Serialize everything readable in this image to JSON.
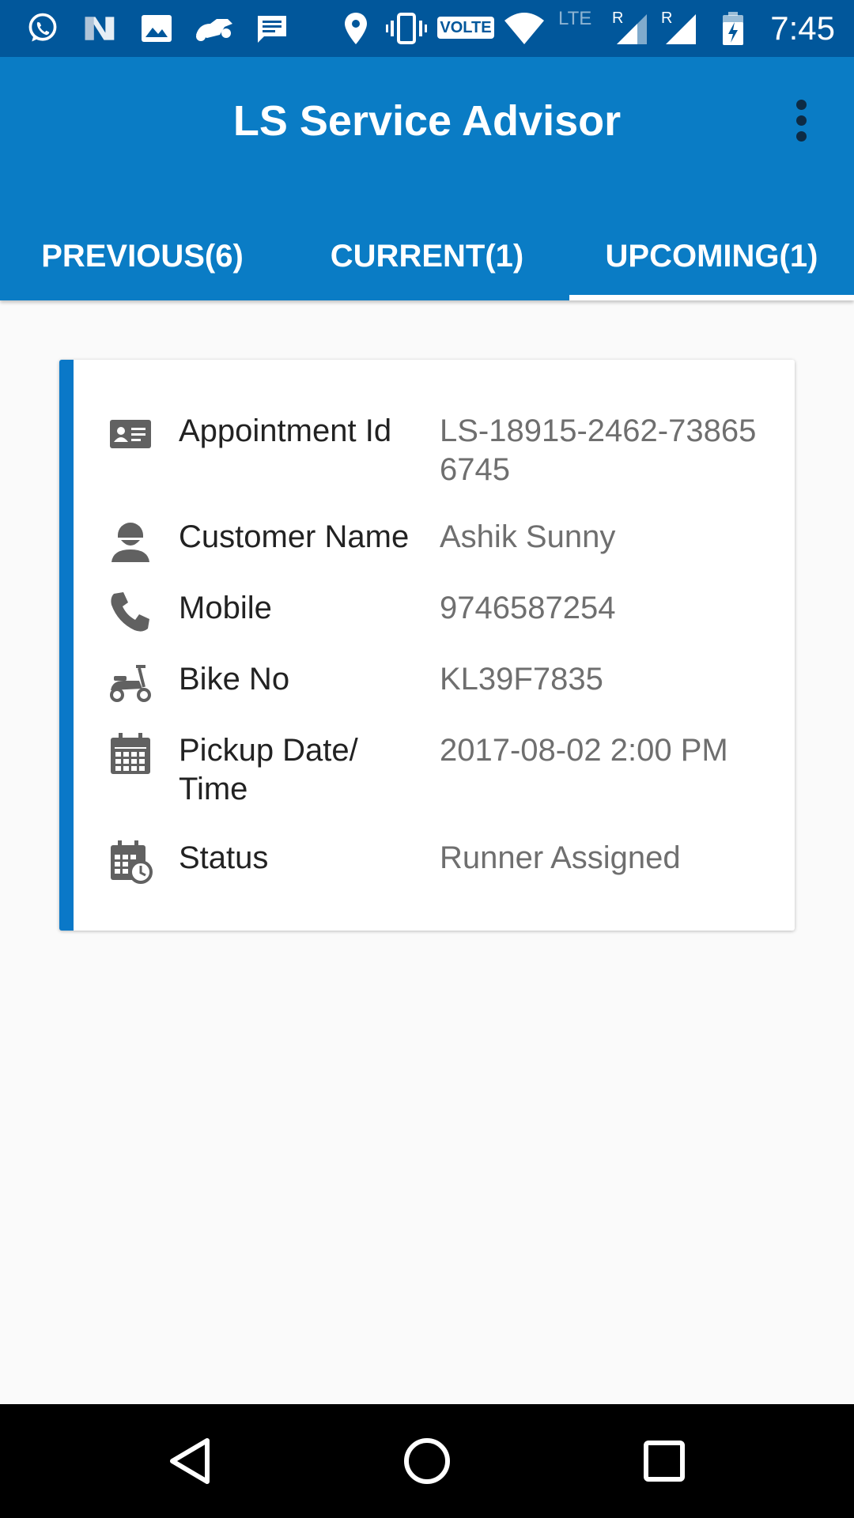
{
  "status_bar": {
    "icons": [
      "whatsapp-icon",
      "n-notification-icon",
      "gallery-icon",
      "bike-notification-icon",
      "message-icon",
      "location-icon",
      "vibrate-icon",
      "wifi-icon",
      "signal-icon",
      "signal-icon",
      "battery-charging-icon"
    ],
    "volte": "VOLTE",
    "lte": "LTE",
    "roaming_1": "R",
    "roaming_2": "R",
    "time": "7:45"
  },
  "app_bar": {
    "title": "LS Service Advisor",
    "overflow_icon": "more-vert-icon",
    "color": "#0a7cc5"
  },
  "tabs": [
    {
      "label": "PREVIOUS(6)",
      "active": false
    },
    {
      "label": "CURRENT(1)",
      "active": false
    },
    {
      "label": "UPCOMING(1)",
      "active": true
    }
  ],
  "appointment": {
    "accent_color": "#0a78c8",
    "rows": [
      {
        "icon": "id-card-icon",
        "label": "Appointment Id",
        "value": "LS-18915-2462-738656745"
      },
      {
        "icon": "person-icon",
        "label": "Customer Name",
        "value": "Ashik Sunny"
      },
      {
        "icon": "phone-icon",
        "label": "Mobile",
        "value": "9746587254"
      },
      {
        "icon": "scooter-icon",
        "label": "Bike No",
        "value": "KL39F7835"
      },
      {
        "icon": "calendar-icon",
        "label": "Pickup Date/ Time",
        "value": "2017-08-02 2:00 PM"
      },
      {
        "icon": "calendar-clock-icon",
        "label": "Status",
        "value": "Runner Assigned"
      }
    ]
  },
  "nav_bar": {
    "buttons": [
      "back-icon",
      "home-icon",
      "recents-icon"
    ]
  }
}
